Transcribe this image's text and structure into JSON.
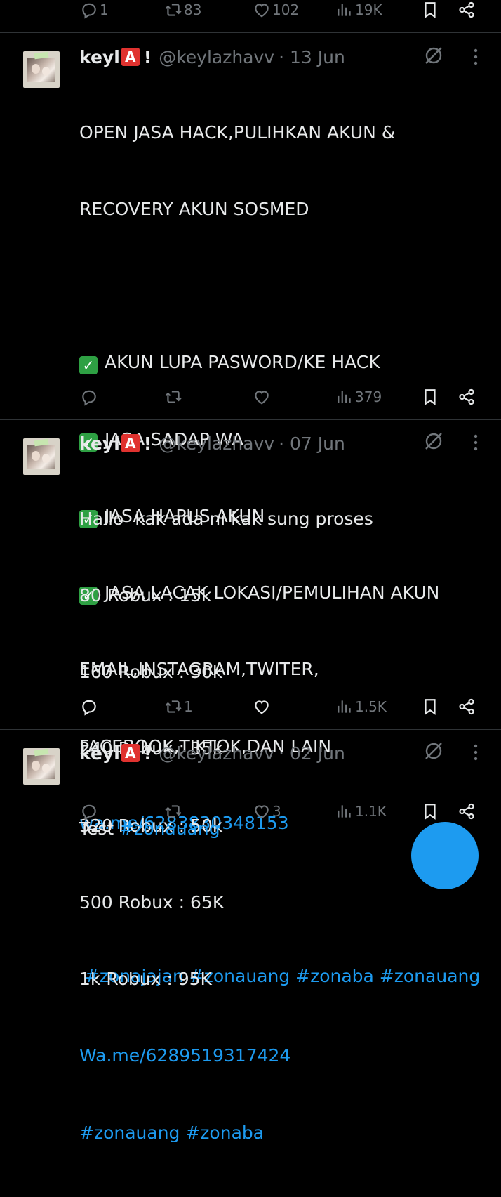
{
  "top_actions": {
    "reply_count": "1",
    "retweet_count": "83",
    "like_count": "102",
    "view_count": "19K"
  },
  "tweets": [
    {
      "name": "keyl",
      "badge": "A",
      "bang": "!",
      "handle": "@keylazhavv",
      "date": "· 13 Jun",
      "lines": {
        "l1": "OPEN JASA HACK,PULIHKAN AKUN &",
        "l2": "RECOVERY AKUN SOSMED",
        "c1": "AKUN LUPA PASWORD/KE HACK",
        "c2": "JASA SADAP WA",
        "c3": "JASA HAPUS AKUN",
        "c4": "JASA LACAK LOKASI/PEMULIHAN AKUN",
        "l7": "EMAIL,INSTAGRAM,TWITER,",
        "l8": "FACEBOOK,TIKTOK,DAN LAIN",
        "link": "wa.me/6283830348153",
        "hashtags": " #zonajajan #zonauang #zonaba #zonauang"
      },
      "check_glyph": "✓",
      "reply_count": "",
      "retweet_count": "",
      "like_count": "",
      "view_count": "379"
    },
    {
      "name": "keyl",
      "badge": "A",
      "bang": "!",
      "handle": "@keylazhavv",
      "date": "· 07 Jun",
      "lines": {
        "l1": "Hallo  kak ada ni kak sung proses",
        "l2": "80 Robux : 15k",
        "l3": "160 Robux : 30k",
        "l4": "240 Robux : 35k",
        "l5": "320 Robux : 50k",
        "l6": "500 Robux : 65K",
        "l7": "1k Robux : 95K",
        "link": "Wa.me/6289519317424",
        "hashtags": "#zonauang #zonaba"
      },
      "reply_count": "",
      "retweet_count": "1",
      "like_count": "",
      "view_count": "1.5K"
    },
    {
      "name": "keyl",
      "badge": "A",
      "bang": "!",
      "handle": "@keylazhavv",
      "date": "· 02 Jun",
      "lines": {
        "text": "Test ",
        "hashtag": "#zonauang"
      },
      "reply_count": "",
      "retweet_count": "",
      "like_count": "3",
      "view_count": "1.1K"
    }
  ],
  "colors": {
    "background": "#000000",
    "text": "#e7e9ea",
    "muted": "#71767b",
    "link": "#1d9bf0",
    "divider": "#2f3336"
  }
}
